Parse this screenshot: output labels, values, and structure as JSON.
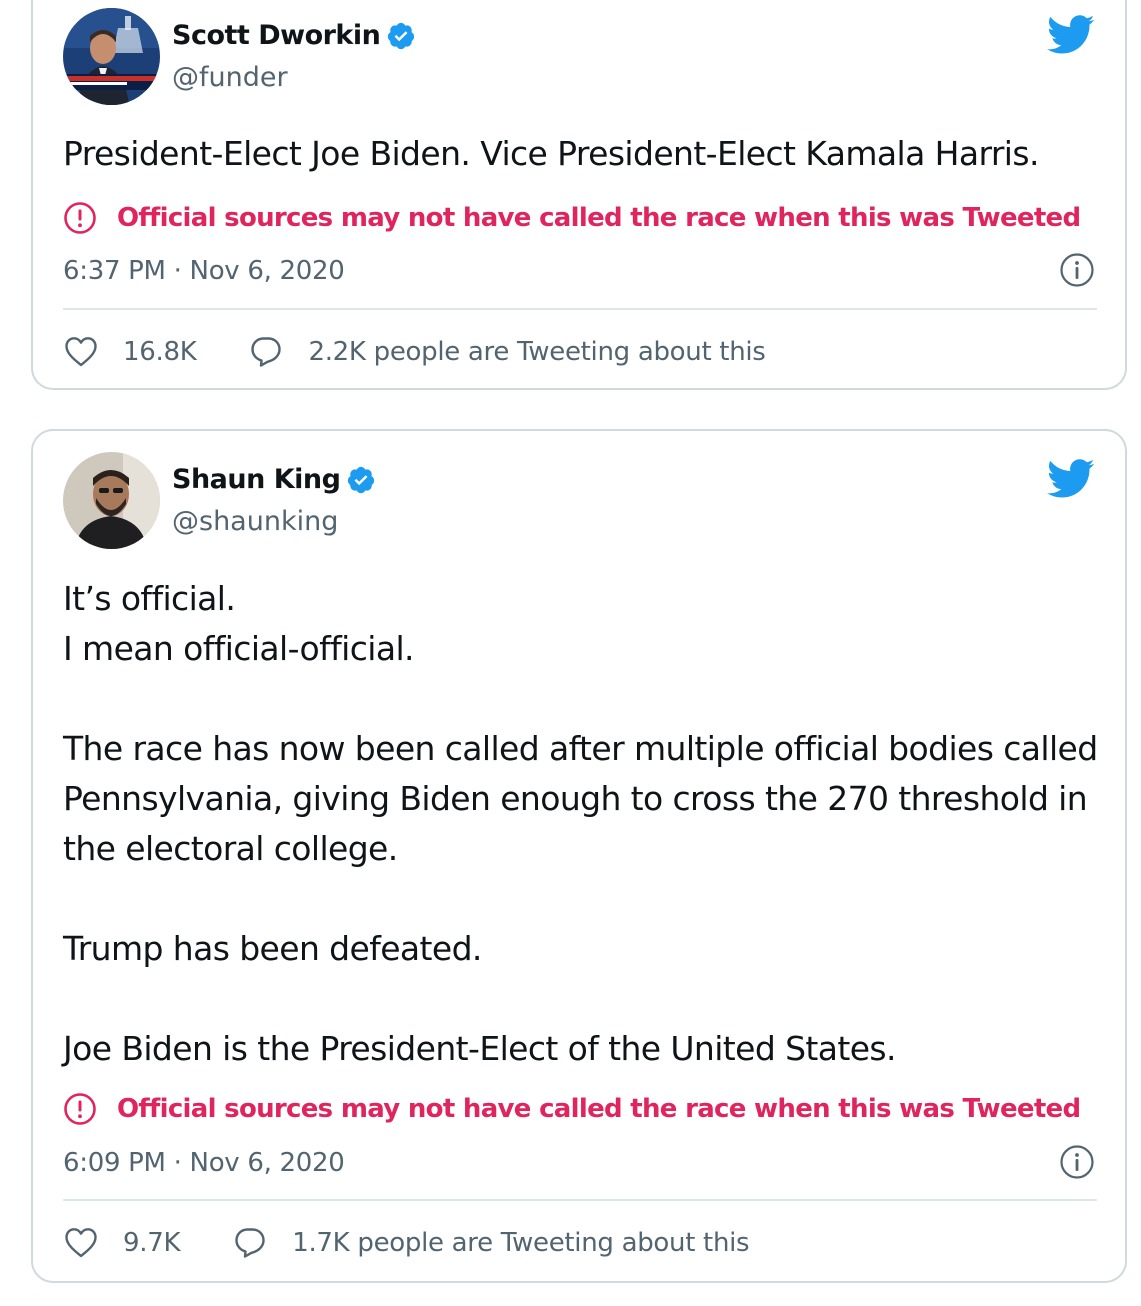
{
  "colors": {
    "accent": "#1d9bf0",
    "warning": "#e0245e",
    "muted": "#536471",
    "text": "#0f1419",
    "border": "#cfd9de"
  },
  "tweets": [
    {
      "author_name": "Scott Dworkin",
      "handle": "@funder",
      "verified": true,
      "text": "President-Elect Joe Biden. Vice President-Elect Kamala Harris.",
      "notice_icon": "alert-circle-icon",
      "notice": "Official sources may not have called the race when this was Tweeted",
      "timestamp": "6:37 PM · Nov 6, 2020",
      "likes": "16.8K",
      "conversation": "2.2K people are Tweeting about this"
    },
    {
      "author_name": "Shaun King",
      "handle": "@shaunking",
      "verified": true,
      "text": "It’s official.\nI mean official-official.\n\nThe race has now been called after multiple official bodies called Pennsylvania, giving Biden enough to cross the 270 threshold in the electoral college.\n\nTrump has been defeated.\n\nJoe Biden is the President-Elect of the United States.",
      "notice_icon": "alert-circle-icon",
      "notice": "Official sources may not have called the race when this was Tweeted",
      "timestamp": "6:09 PM · Nov 6, 2020",
      "likes": "9.7K",
      "conversation": "1.7K people are Tweeting about this"
    }
  ]
}
